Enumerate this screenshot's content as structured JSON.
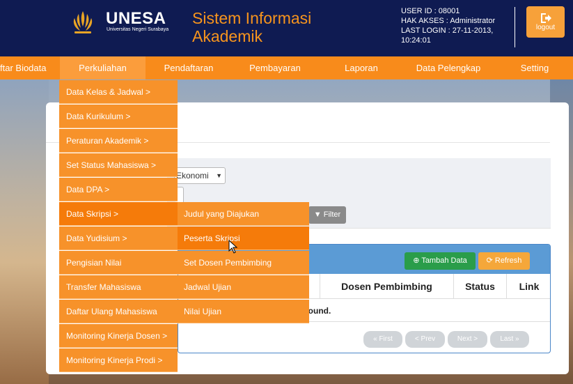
{
  "header": {
    "logo_name": "UNESA",
    "logo_sub": "Universitas Negeri Surabaya",
    "app_title_line1": "Sistem Informasi",
    "app_title_line2": "Akademik",
    "user_id": "USER ID : 08001",
    "hak_akses": "HAK AKSES : Administrator",
    "last_login_1": "LAST LOGIN : 27-11-2013,",
    "last_login_2": "10:24:01",
    "logout_label": "logout"
  },
  "nav": {
    "items": [
      {
        "label": "ftar Biodata"
      },
      {
        "label": "Perkuliahan"
      },
      {
        "label": "Pendaftaran"
      },
      {
        "label": "Pembayaran"
      },
      {
        "label": "Laporan"
      },
      {
        "label": "Data Pelengkap"
      },
      {
        "label": "Setting"
      }
    ]
  },
  "dropdown": {
    "items": [
      {
        "label": "Data Kelas & Jadwal >"
      },
      {
        "label": "Data Kurikulum >"
      },
      {
        "label": "Peraturan Akademik >"
      },
      {
        "label": "Set Status Mahasiswa >"
      },
      {
        "label": "Data DPA >"
      },
      {
        "label": "Data Skripsi >"
      },
      {
        "label": "Data Yudisium >"
      },
      {
        "label": "Pengisian Nilai"
      },
      {
        "label": "Transfer Mahasiswa"
      },
      {
        "label": "Daftar Ulang Mahasiswa"
      },
      {
        "label": "Monitoring Kinerja Dosen >"
      },
      {
        "label": "Monitoring Kinerja Prodi >"
      }
    ]
  },
  "submenu": {
    "items": [
      {
        "label": "Judul yang Diajukan"
      },
      {
        "label": "Peserta Skripsi"
      },
      {
        "label": "Set Dosen Pembimbing"
      },
      {
        "label": "Jadwal Ujian"
      },
      {
        "label": "Nilai Ujian"
      }
    ]
  },
  "filter": {
    "select_value": "Ekonomi",
    "filter_label": "Filter"
  },
  "table": {
    "tambah_label": "Tambah Data",
    "refresh_label": "Refresh",
    "columns": [
      "Dosen Pembimbing",
      "Status",
      "Link"
    ],
    "empty_text": "d found.",
    "pager": [
      "« First",
      "< Prev",
      "Next >",
      "Last »"
    ]
  },
  "colors": {
    "header_bg": "#0f1b52",
    "accent_orange": "#f88b1b",
    "title_orange": "#f7941d",
    "table_header_blue": "#5b9bd5",
    "tambah_green": "#2a9d4a"
  }
}
